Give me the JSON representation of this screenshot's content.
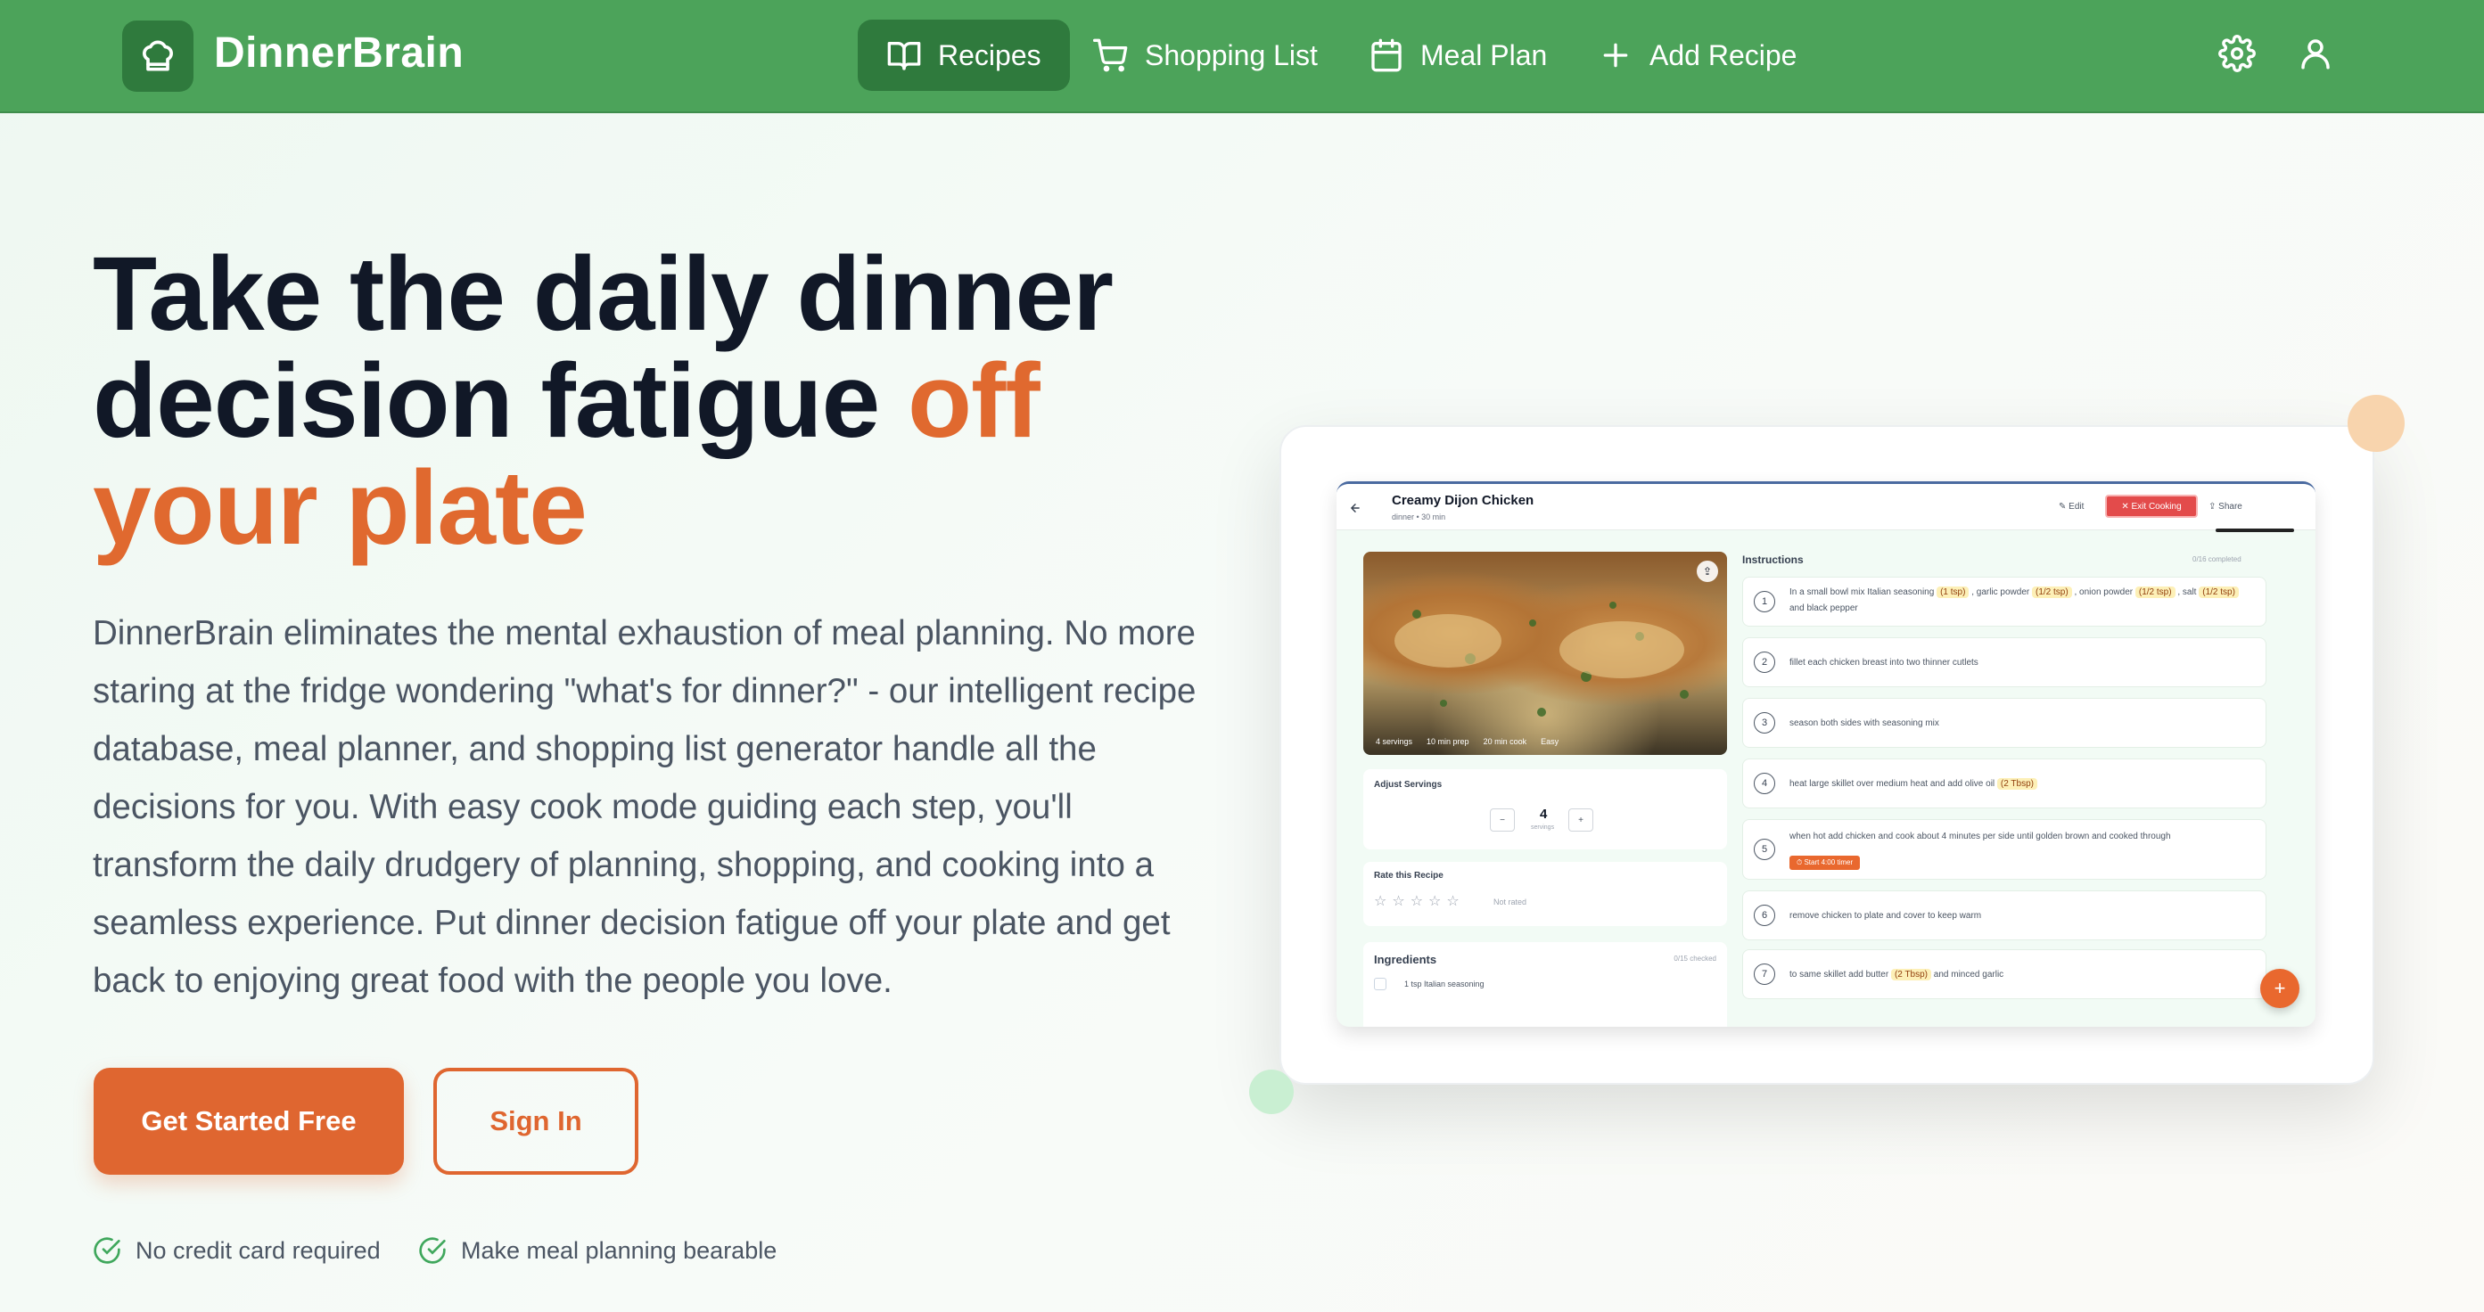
{
  "nav": {
    "brand": "DinnerBrain",
    "items": [
      {
        "label": "Recipes"
      },
      {
        "label": "Shopping List"
      },
      {
        "label": "Meal Plan"
      },
      {
        "label": "Add Recipe"
      }
    ]
  },
  "hero": {
    "title_line1": "Take the daily dinner",
    "title_line2a": "decision fatigue ",
    "title_line2b": "off",
    "title_line3": "your plate",
    "description": "DinnerBrain eliminates the mental exhaustion of meal planning. No more staring at the fridge wondering \"what's for dinner?\" - our intelligent recipe database, meal planner, and shopping list generator handle all the decisions for you. With easy cook mode guiding each step, you'll transform the daily drudgery of planning, shopping, and cooking into a seamless experience. Put dinner decision fatigue off your plate and get back to enjoying great food with the people you love.",
    "primary_cta": "Get Started Free",
    "secondary_cta": "Sign In",
    "perks": [
      "No credit card required",
      "Make meal planning bearable"
    ]
  },
  "preview": {
    "recipe_title": "Creamy Dijon Chicken",
    "recipe_meta": "dinner • 30 min",
    "edit": "Edit",
    "exit": "Exit Cooking",
    "share": "Share",
    "image_meta": [
      "4 servings",
      "10 min prep",
      "20 min cook",
      "Easy"
    ],
    "adjust_servings": "Adjust Servings",
    "servings_value": "4",
    "servings_label": "servings",
    "rate_title": "Rate this Recipe",
    "rate_status": "Not rated",
    "ingredients_title": "Ingredients",
    "ingredients_count": "0/15 checked",
    "ingredient_first": "1 tsp Italian seasoning",
    "instructions_title": "Instructions",
    "instructions_count": "0/16 completed",
    "timer_label": "Start 4:00 timer",
    "steps": [
      {
        "n": "1",
        "parts": [
          "In a small bowl mix Italian seasoning ",
          "(1 tsp)",
          " , garlic powder ",
          "(1/2 tsp)",
          " , onion powder ",
          "(1/2 tsp)",
          " , salt ",
          "(1/2 tsp)",
          " and black pepper"
        ]
      },
      {
        "n": "2",
        "text": "fillet each chicken breast into two thinner cutlets"
      },
      {
        "n": "3",
        "text": "season both sides with seasoning mix"
      },
      {
        "n": "4",
        "parts": [
          "heat large skillet over medium heat and add olive oil ",
          "(2 Tbsp)"
        ]
      },
      {
        "n": "5",
        "text": "when hot add chicken and cook about 4 minutes per side until golden brown and cooked through"
      },
      {
        "n": "6",
        "text": "remove chicken to plate and cover to keep warm"
      },
      {
        "n": "7",
        "parts": [
          "to same skillet add butter ",
          "(2 Tbsp)",
          " and minced garlic"
        ]
      }
    ]
  }
}
